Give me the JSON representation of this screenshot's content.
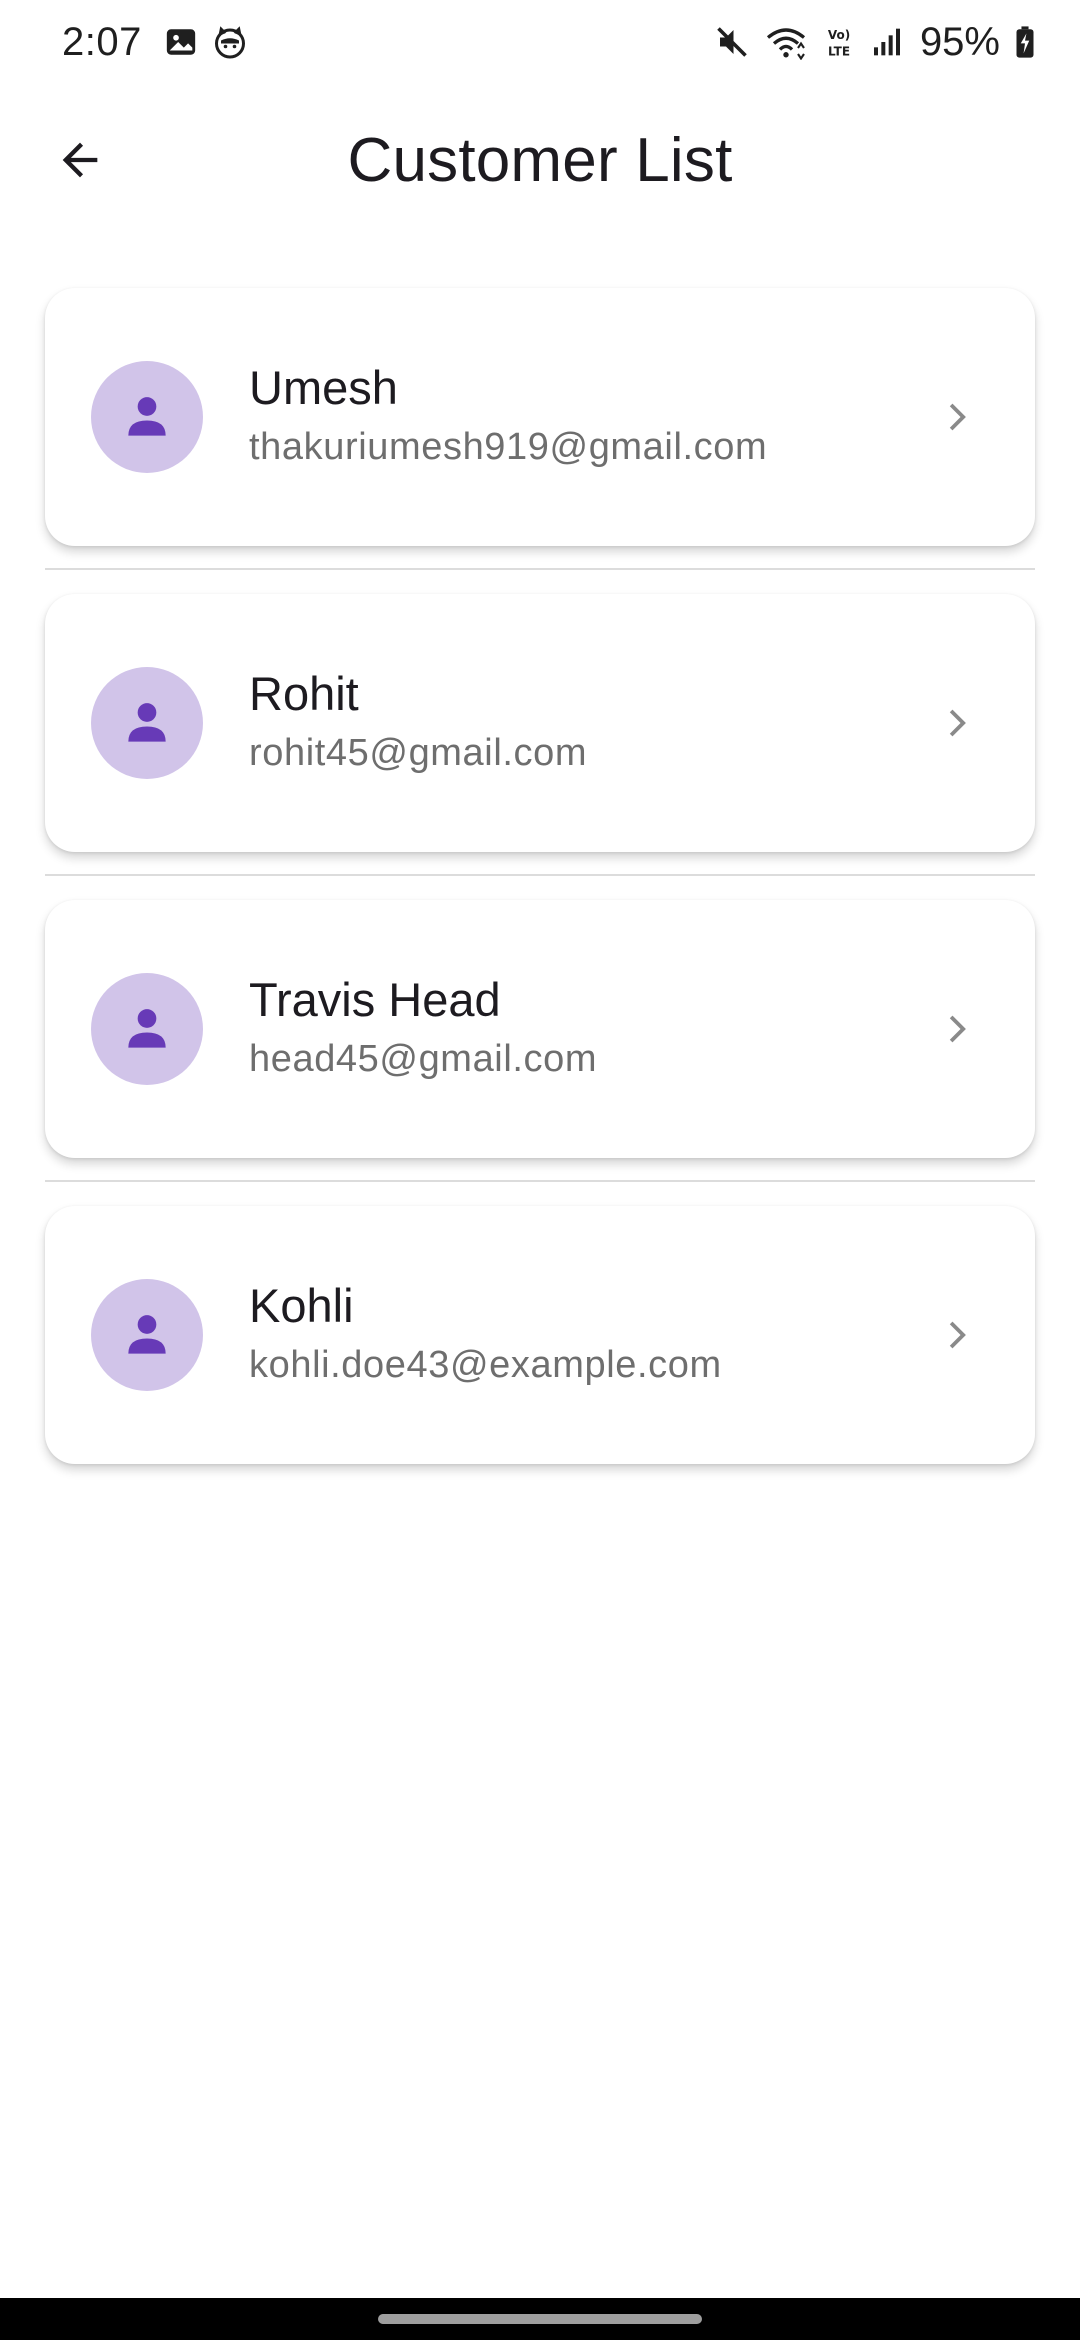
{
  "status_bar": {
    "time": "2:07",
    "battery": "95%",
    "icons": [
      "gallery-icon",
      "cat-face-icon",
      "mute-icon",
      "wifi-icon",
      "volte-icon",
      "signal-icon",
      "battery-charging-icon"
    ]
  },
  "app_bar": {
    "title": "Customer List",
    "back_icon": "arrow-back-icon"
  },
  "customers": [
    {
      "name": "Umesh",
      "email": "thakuriumesh919@gmail.com"
    },
    {
      "name": "Rohit",
      "email": "rohit45@gmail.com"
    },
    {
      "name": "Travis Head",
      "email": "head45@gmail.com"
    },
    {
      "name": "Kohli",
      "email": "kohli.doe43@example.com"
    }
  ],
  "colors": {
    "accent": "#673ab7",
    "avatar_bg": "#d1c4e9",
    "secondary_text": "#6e6e6e",
    "chevron": "#8a8a8a"
  }
}
